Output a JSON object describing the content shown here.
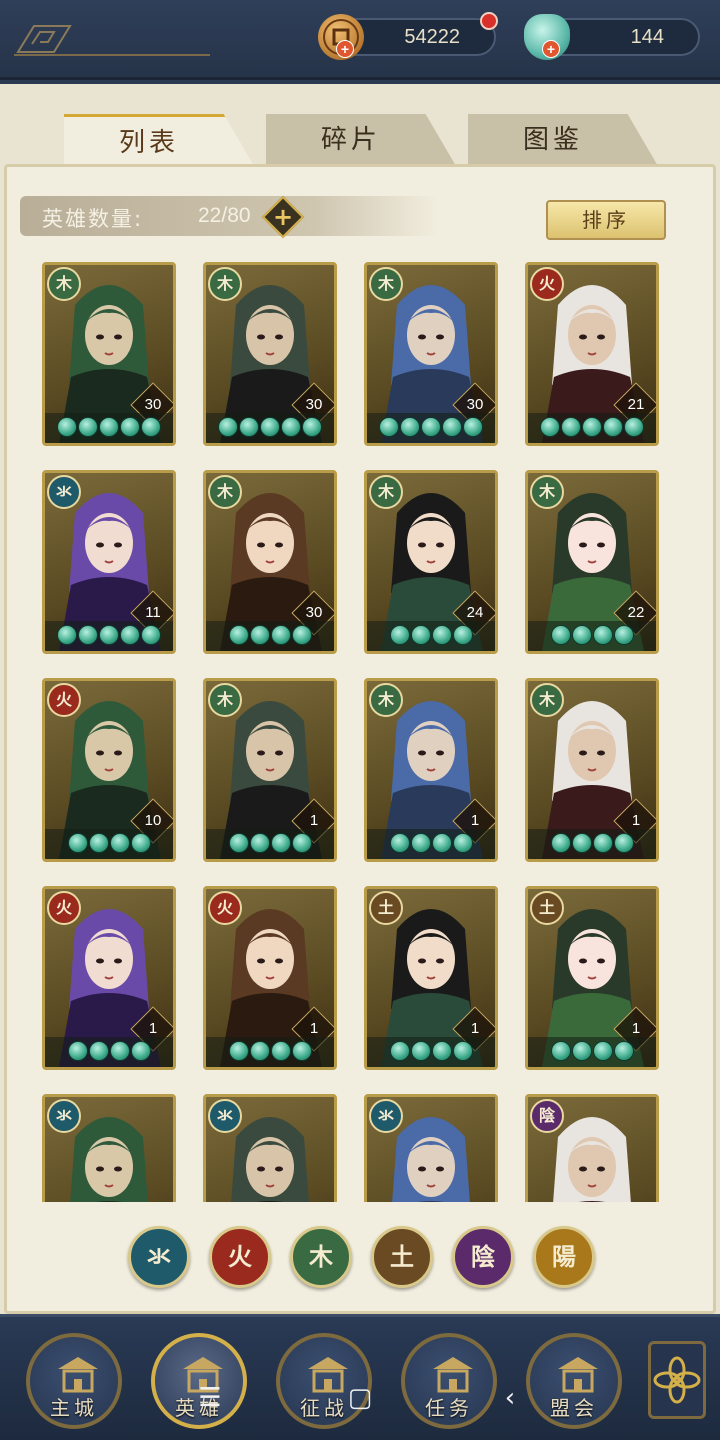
{
  "currency": {
    "copper": "54222",
    "jade": "144",
    "plus": "+"
  },
  "tabs": [
    {
      "label": "列表",
      "active": true
    },
    {
      "label": "碎片",
      "active": false
    },
    {
      "label": "图鉴",
      "active": false
    }
  ],
  "hero_count": {
    "label": "英雄数量:",
    "value": "22/80",
    "add": "+"
  },
  "sort_label": "排序",
  "heroes": [
    {
      "element": "wood",
      "level": "30",
      "stars": 5
    },
    {
      "element": "wood",
      "level": "30",
      "stars": 5
    },
    {
      "element": "wood",
      "level": "30",
      "stars": 5
    },
    {
      "element": "fire",
      "level": "21",
      "stars": 5
    },
    {
      "element": "water",
      "level": "11",
      "stars": 5
    },
    {
      "element": "wood",
      "level": "30",
      "stars": 4
    },
    {
      "element": "wood",
      "level": "24",
      "stars": 4
    },
    {
      "element": "wood",
      "level": "22",
      "stars": 4
    },
    {
      "element": "fire",
      "level": "10",
      "stars": 4
    },
    {
      "element": "wood",
      "level": "1",
      "stars": 4
    },
    {
      "element": "wood",
      "level": "1",
      "stars": 4
    },
    {
      "element": "wood",
      "level": "1",
      "stars": 4
    },
    {
      "element": "fire",
      "level": "1",
      "stars": 4
    },
    {
      "element": "fire",
      "level": "1",
      "stars": 4
    },
    {
      "element": "earth",
      "level": "1",
      "stars": 4
    },
    {
      "element": "earth",
      "level": "1",
      "stars": 4
    },
    {
      "element": "water",
      "level": "",
      "stars": 0
    },
    {
      "element": "water",
      "level": "",
      "stars": 0
    },
    {
      "element": "water",
      "level": "",
      "stars": 0
    },
    {
      "element": "yin",
      "level": "",
      "stars": 0
    }
  ],
  "elements": {
    "water": {
      "glyph": "氺",
      "color": "#1e5a6a"
    },
    "fire": {
      "glyph": "火",
      "color": "#9a2a1e"
    },
    "wood": {
      "glyph": "木",
      "color": "#3a6a42"
    },
    "earth": {
      "glyph": "土",
      "color": "#6a4a22"
    },
    "yin": {
      "glyph": "陰",
      "color": "#5a2a6a"
    },
    "yang": {
      "glyph": "陽",
      "color": "#a8781a"
    }
  },
  "filters": [
    "water",
    "fire",
    "wood",
    "earth",
    "yin",
    "yang"
  ],
  "nav": [
    {
      "label": "主城",
      "icon": "palace-icon",
      "active": false
    },
    {
      "label": "英雄",
      "icon": "hero-icon",
      "active": true
    },
    {
      "label": "征战",
      "icon": "battle-icon",
      "active": false
    },
    {
      "label": "任务",
      "icon": "scroll-icon",
      "active": false
    },
    {
      "label": "盟会",
      "icon": "guild-icon",
      "active": false
    }
  ],
  "system_nav": {
    "menu": "☰",
    "home": "▢",
    "back": "‹"
  }
}
